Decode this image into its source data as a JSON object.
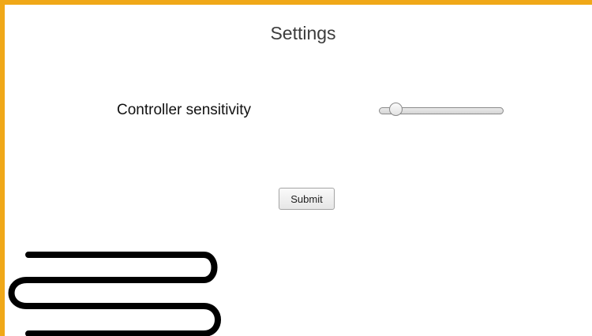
{
  "page": {
    "title": "Settings"
  },
  "settings": {
    "controller_sensitivity": {
      "label": "Controller sensitivity",
      "value_fraction": 0.14
    }
  },
  "actions": {
    "submit_label": "Submit"
  },
  "colors": {
    "frame_accent": "#f0a818",
    "scribble_ink": "#000000"
  }
}
